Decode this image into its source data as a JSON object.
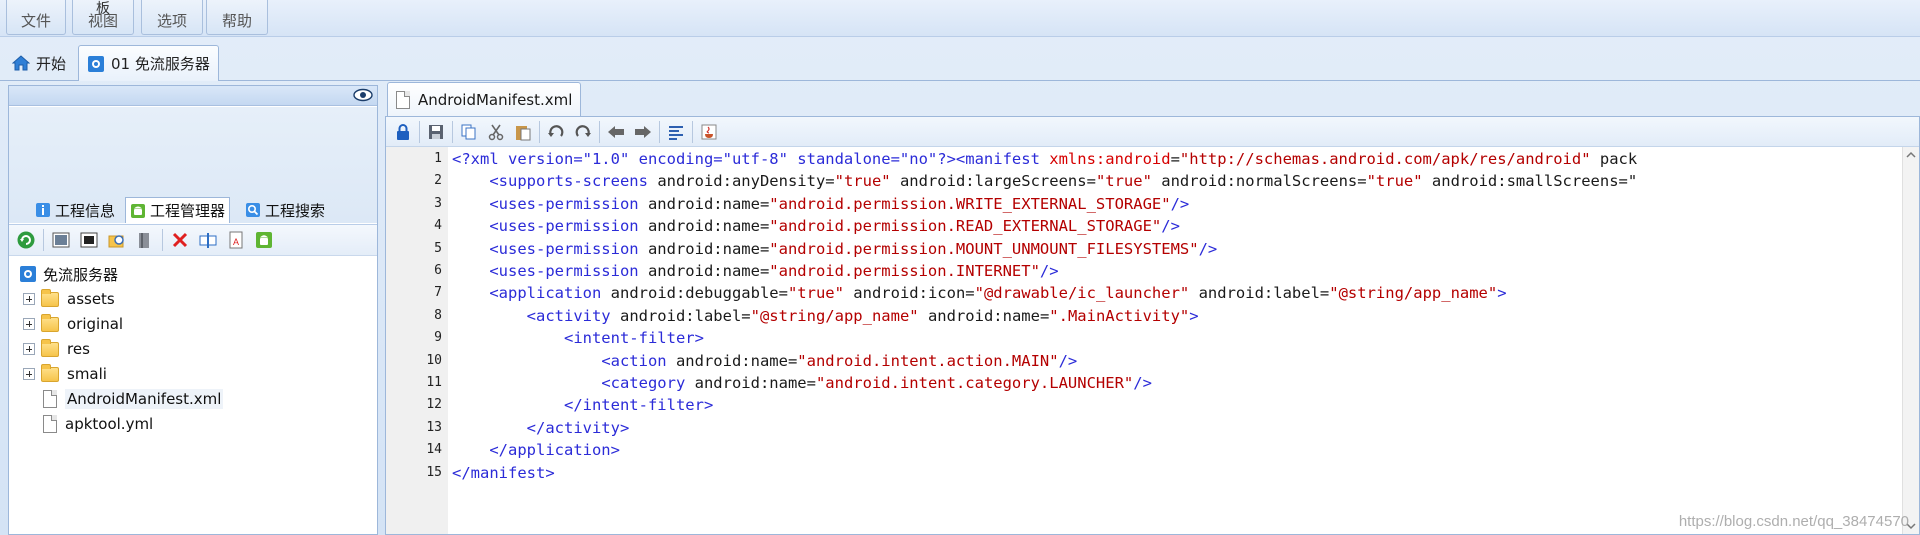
{
  "menu": {
    "items": [
      {
        "label": "文件",
        "sup": ""
      },
      {
        "label": "视图",
        "sup": "板"
      },
      {
        "label": "选项",
        "sup": ""
      },
      {
        "label": "帮助",
        "sup": ""
      }
    ]
  },
  "doc_tabs": [
    {
      "label": "开始",
      "icon": "home-icon"
    },
    {
      "label": "01 免流服务器",
      "icon": "project-icon"
    }
  ],
  "left": {
    "sub_tabs": [
      {
        "label": "工程信息",
        "icon": "info-icon"
      },
      {
        "label": "工程管理器",
        "icon": "android-icon"
      },
      {
        "label": "工程搜索",
        "icon": "search-icon"
      }
    ],
    "toolbar_icons": [
      "refresh-icon",
      "image-icon",
      "window-icon",
      "find-folder-icon",
      "book-icon",
      "delete-icon",
      "rename-icon",
      "text-file-icon",
      "android-build-icon"
    ],
    "tree": {
      "root": "免流服务器",
      "items": [
        {
          "label": "assets",
          "type": "folder"
        },
        {
          "label": "original",
          "type": "folder"
        },
        {
          "label": "res",
          "type": "folder"
        },
        {
          "label": "smali",
          "type": "folder"
        },
        {
          "label": "AndroidManifest.xml",
          "type": "file"
        },
        {
          "label": "apktool.yml",
          "type": "file"
        }
      ]
    }
  },
  "editor": {
    "tab_label": "AndroidManifest.xml",
    "toolbar_icons": [
      "lock-icon",
      "save-icon",
      "copy-icon",
      "cut-icon",
      "paste-icon",
      "undo-icon",
      "redo-icon",
      "back-icon",
      "forward-icon",
      "format-icon",
      "java-icon"
    ],
    "lines": [
      [
        [
          "t",
          "<?xml version=\"1.0\" encoding=\"utf-8\" standalone=\"no\"?>"
        ],
        [
          "t",
          "<manifest "
        ],
        [
          "a",
          "xmlns:android"
        ],
        [
          "p",
          "="
        ],
        [
          "v",
          "\"http://schemas.android.com/apk/res/android\""
        ],
        [
          "p",
          " pack"
        ]
      ],
      [
        [
          "p",
          "    "
        ],
        [
          "t",
          "<supports-screens "
        ],
        [
          "p",
          "android:anyDensity="
        ],
        [
          "v",
          "\"true\""
        ],
        [
          "p",
          " android:largeScreens="
        ],
        [
          "v",
          "\"true\""
        ],
        [
          "p",
          " android:normalScreens="
        ],
        [
          "v",
          "\"true\""
        ],
        [
          "p",
          " android:smallScreens=\""
        ]
      ],
      [
        [
          "p",
          "    "
        ],
        [
          "t",
          "<uses-permission "
        ],
        [
          "p",
          "android:name="
        ],
        [
          "v",
          "\"android.permission.WRITE_EXTERNAL_STORAGE\""
        ],
        [
          "t",
          "/>"
        ]
      ],
      [
        [
          "p",
          "    "
        ],
        [
          "t",
          "<uses-permission "
        ],
        [
          "p",
          "android:name="
        ],
        [
          "v",
          "\"android.permission.READ_EXTERNAL_STORAGE\""
        ],
        [
          "t",
          "/>"
        ]
      ],
      [
        [
          "p",
          "    "
        ],
        [
          "t",
          "<uses-permission "
        ],
        [
          "p",
          "android:name="
        ],
        [
          "v",
          "\"android.permission.MOUNT_UNMOUNT_FILESYSTEMS\""
        ],
        [
          "t",
          "/>"
        ]
      ],
      [
        [
          "p",
          "    "
        ],
        [
          "t",
          "<uses-permission "
        ],
        [
          "p",
          "android:name="
        ],
        [
          "v",
          "\"android.permission.INTERNET\""
        ],
        [
          "t",
          "/>"
        ]
      ],
      [
        [
          "p",
          "    "
        ],
        [
          "t",
          "<application "
        ],
        [
          "p",
          "android:debuggable="
        ],
        [
          "v",
          "\"true\""
        ],
        [
          "p",
          " android:icon="
        ],
        [
          "v",
          "\"@drawable/ic_launcher\""
        ],
        [
          "p",
          " android:label="
        ],
        [
          "v",
          "\"@string/app_name\""
        ],
        [
          "t",
          ">"
        ]
      ],
      [
        [
          "p",
          "        "
        ],
        [
          "t",
          "<activity "
        ],
        [
          "p",
          "android:label="
        ],
        [
          "v",
          "\"@string/app_name\""
        ],
        [
          "p",
          " android:name="
        ],
        [
          "v",
          "\".MainActivity\""
        ],
        [
          "t",
          ">"
        ]
      ],
      [
        [
          "p",
          "            "
        ],
        [
          "t",
          "<intent-filter>"
        ]
      ],
      [
        [
          "p",
          "                "
        ],
        [
          "t",
          "<action "
        ],
        [
          "p",
          "android:name="
        ],
        [
          "v",
          "\"android.intent.action.MAIN\""
        ],
        [
          "t",
          "/>"
        ]
      ],
      [
        [
          "p",
          "                "
        ],
        [
          "t",
          "<category "
        ],
        [
          "p",
          "android:name="
        ],
        [
          "v",
          "\"android.intent.category.LAUNCHER\""
        ],
        [
          "t",
          "/>"
        ]
      ],
      [
        [
          "p",
          "            "
        ],
        [
          "t",
          "</intent-filter>"
        ]
      ],
      [
        [
          "p",
          "        "
        ],
        [
          "t",
          "</activity>"
        ]
      ],
      [
        [
          "p",
          "    "
        ],
        [
          "t",
          "</application>"
        ]
      ],
      [
        [
          "t",
          "</manifest>"
        ]
      ]
    ]
  },
  "colors": {
    "tag": "#2b2bd8",
    "attr_red": "#d60000",
    "value": "#b40000",
    "plain": "#1a1a1a"
  },
  "watermark": "https://blog.csdn.net/qq_38474570"
}
